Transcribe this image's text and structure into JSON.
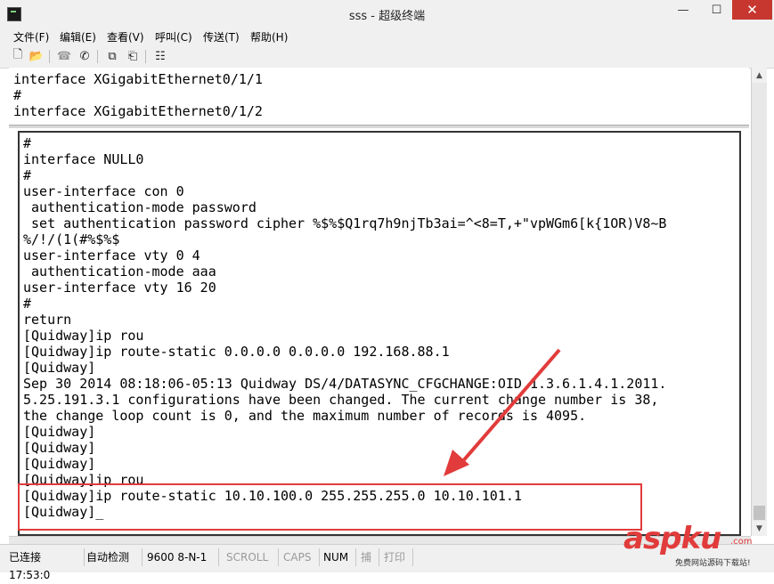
{
  "window": {
    "title": "sss - 超级终端",
    "minimize_glyph": "—",
    "maximize_glyph": "☐",
    "close_glyph": "✕"
  },
  "menu": [
    "文件(F)",
    "编辑(E)",
    "查看(V)",
    "呼叫(C)",
    "传送(T)",
    "帮助(H)"
  ],
  "toolbar": [
    {
      "name": "new-icon",
      "glyph": "🗋"
    },
    {
      "name": "open-icon",
      "glyph": "📂"
    },
    {
      "name": "call-icon",
      "glyph": "☎"
    },
    {
      "name": "disconnect-icon",
      "glyph": "✆"
    },
    {
      "name": "send-icon",
      "glyph": "⧉"
    },
    {
      "name": "receive-icon",
      "glyph": "⎗"
    },
    {
      "name": "properties-icon",
      "glyph": "☷"
    }
  ],
  "terminal": {
    "upper_lines": [
      "interface XGigabitEthernet0/1/1",
      "#",
      "interface XGigabitEthernet0/1/2"
    ],
    "lower_lines": [
      "#",
      "interface NULL0",
      "#",
      "user-interface con 0",
      " authentication-mode password",
      " set authentication password cipher %$%$Q1rq7h9njTb3ai=^<8=T,+\"vpWGm6[k{1OR)V8~B",
      "%/!/(1(#%$%$",
      "user-interface vty 0 4",
      " authentication-mode aaa",
      "user-interface vty 16 20",
      "#",
      "return",
      "[Quidway]ip rou",
      "[Quidway]ip route-static 0.0.0.0 0.0.0.0 192.168.88.1",
      "[Quidway]",
      "Sep 30 2014 08:18:06-05:13 Quidway DS/4/DATASYNC_CFGCHANGE:OID 1.3.6.1.4.1.2011.",
      "5.25.191.3.1 configurations have been changed. The current change number is 38,",
      "the change loop count is 0, and the maximum number of records is 4095.",
      "[Quidway]",
      "[Quidway]",
      "[Quidway]",
      "[Quidway]ip rou",
      "[Quidway]ip route-static 10.10.100.0 255.255.255.0 10.10.101.1",
      "[Quidway]_"
    ]
  },
  "status": {
    "connected": "已连接 17:53:0",
    "detect": "自动检测",
    "params": "9600 8-N-1",
    "scroll": "SCROLL",
    "caps": "CAPS",
    "num": "NUM",
    "capture": "捕",
    "print": "打印"
  },
  "watermark": {
    "brand": "aspku",
    "brand_suffix": ".com",
    "sub": "免费网站源码下载站!"
  },
  "colors": {
    "highlight": "#e23b3b",
    "close_button": "#c7372f"
  }
}
